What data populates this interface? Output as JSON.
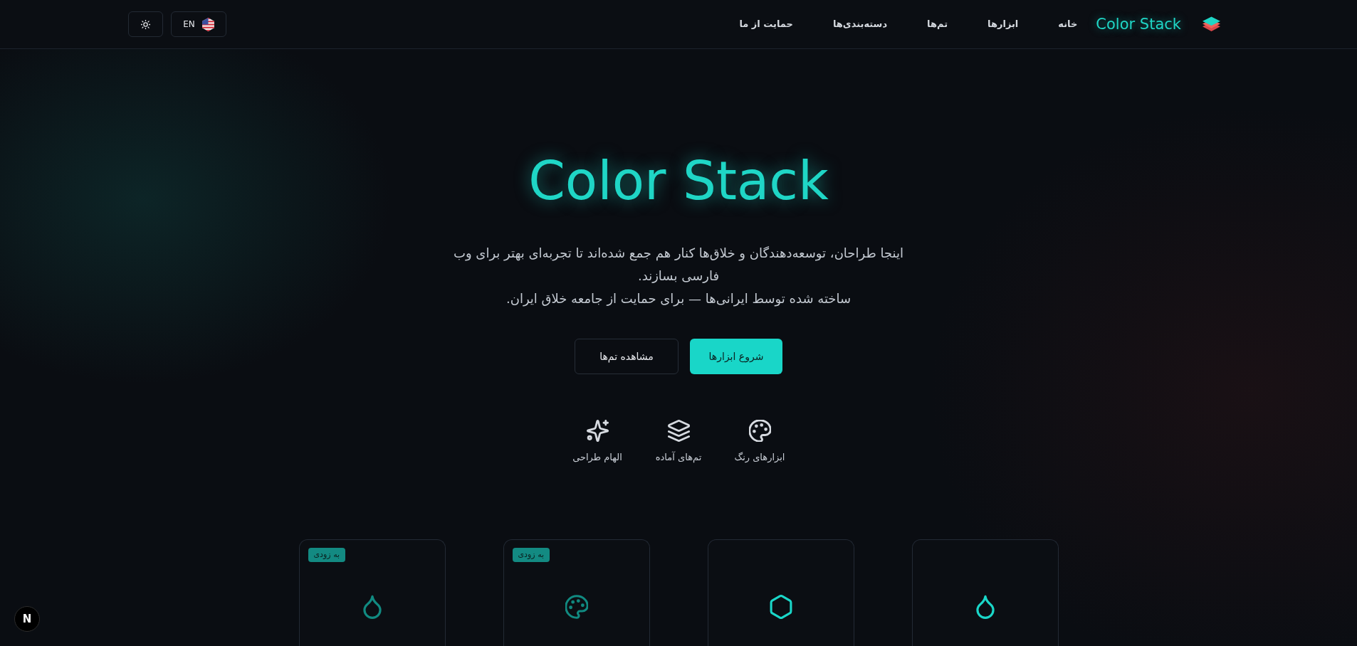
{
  "header": {
    "brand": "Color Stack",
    "nav": [
      {
        "label": "خانه"
      },
      {
        "label": "ابزارها"
      },
      {
        "label": "تم‌ها"
      },
      {
        "label": "دسته‌بندی‌ها"
      },
      {
        "label": "حمایت از ما"
      }
    ],
    "language": "EN"
  },
  "hero": {
    "title": "Color Stack",
    "description": "اینجا طراحان، توسعه‌دهندگان و خلاق‌ها کنار هم جمع شده‌اند تا تجربه‌ای بهتر برای وب فارسی بسازند.",
    "tagline": "ساخته شده توسط ایرانی‌ها — برای حمایت از جامعه خلاق ایران.",
    "buttons": [
      {
        "label": "شروع ابزارها",
        "kind": "primary"
      },
      {
        "label": "مشاهده تم‌ها",
        "kind": "secondary"
      }
    ],
    "features": [
      {
        "label": "ابزارهای رنگ"
      },
      {
        "label": "تم‌های آماده"
      },
      {
        "label": "الهام طراحی"
      }
    ]
  },
  "cards": [
    {
      "disabled": false
    },
    {
      "disabled": false
    },
    {
      "badge": "به زودی",
      "disabled": true
    },
    {
      "badge": "به زودی",
      "disabled": true
    }
  ],
  "dev_indicator": {
    "label": "N"
  }
}
